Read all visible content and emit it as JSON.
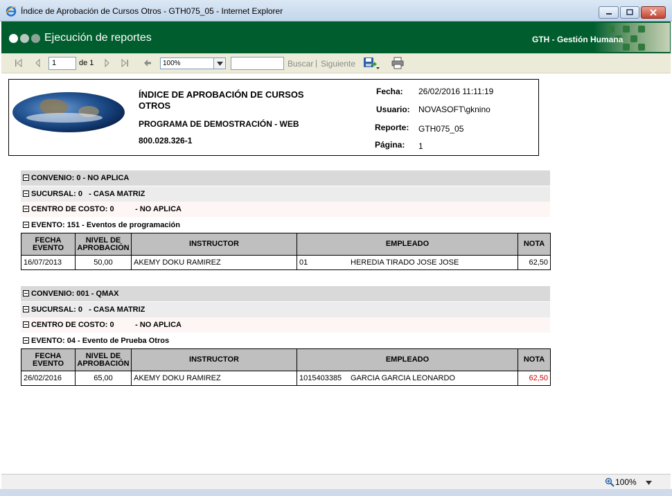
{
  "window": {
    "title": "Índice de Aprobación de Cursos Otros - GTH075_05 - Internet Explorer"
  },
  "banner": {
    "title": "Ejecución de reportes",
    "brand": "GTH - Gestión Humana"
  },
  "toolbar": {
    "page_value": "1",
    "page_of": "de 1",
    "zoom_value": "100%",
    "find_placeholder": "",
    "find_label": "Buscar",
    "separator": "|",
    "next_label": "Siguiente"
  },
  "report": {
    "title": "ÍNDICE DE APROBACIÓN DE CURSOS OTROS",
    "subtitle": "PROGRAMA DE DEMOSTRACIÓN - WEB",
    "nit": "800.028.326-1",
    "meta": {
      "fecha_label": "Fecha:",
      "fecha_value": "26/02/2016 11:11:19",
      "usuario_label": "Usuario:",
      "usuario_value": "NOVASOFT\\gknino",
      "reporte_label": "Reporte:",
      "reporte_value": "GTH075_05",
      "pagina_label": "Página:",
      "pagina_value": "1"
    },
    "columns": {
      "fecha_a": "FECHA",
      "fecha_b": "EVENTO",
      "nivel_a": "NIVEL DE",
      "nivel_b": "APROBACIÓN",
      "instructor": "INSTRUCTOR",
      "empleado": "EMPLEADO",
      "nota": "NOTA"
    },
    "groups": [
      {
        "convenio": "CONVENIO: 0 - NO APLICA",
        "sucursal": "SUCURSAL: 0   - CASA MATRIZ",
        "centro": "CENTRO DE COSTO: 0          - NO APLICA",
        "evento": "EVENTO: 151 - Eventos de programación",
        "row": {
          "fecha": "16/07/2013",
          "nivel": "50,00",
          "instructor": "AKEMY DOKU RAMIREZ",
          "emp_id": "01",
          "emp_name": "HEREDIA TIRADO JOSE JOSE",
          "nota": "62,50"
        }
      },
      {
        "convenio": "CONVENIO: 001 - QMAX",
        "sucursal": "SUCURSAL: 0   - CASA MATRIZ",
        "centro": "CENTRO DE COSTO: 0          - NO APLICA",
        "evento": "EVENTO: 04 - Evento de Prueba Otros",
        "row": {
          "fecha": "26/02/2016",
          "nivel": "65,00",
          "instructor": "AKEMY DOKU RAMIREZ",
          "emp_id": "1015403385",
          "emp_name": "GARCIA GARCIA LEONARDO",
          "nota": "62,50"
        }
      }
    ]
  },
  "colors": {
    "banner_green": "#005e2e",
    "nota_highlight": "#d00000"
  },
  "statusbar": {
    "zoom": "100%"
  }
}
